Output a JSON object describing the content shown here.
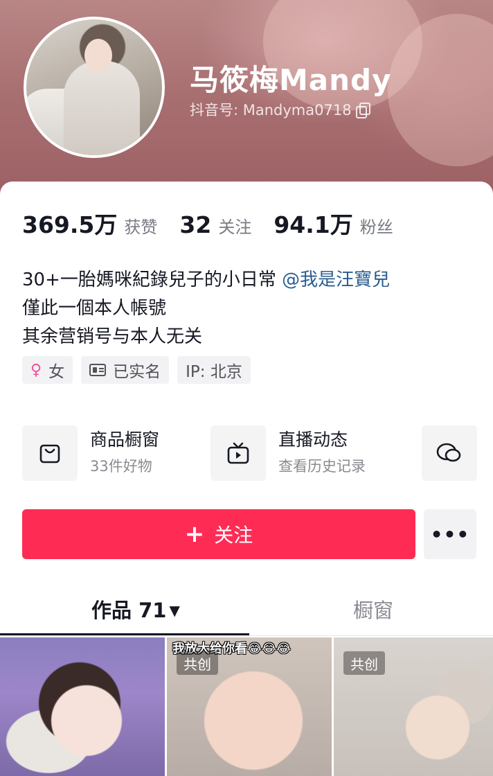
{
  "profile": {
    "name": "马筱梅Mandy",
    "account_id": "抖音号: Mandyma0718"
  },
  "stats": [
    {
      "value": "369.5万",
      "label": "获赞"
    },
    {
      "value": "32",
      "label": "关注"
    },
    {
      "value": "94.1万",
      "label": "粉丝"
    }
  ],
  "bio": {
    "line1": "30+一胎媽咪紀錄兒子的小日常 ",
    "mention": "@我是汪寶兒",
    "line2": "僅此一個本人帳號",
    "line3": "其余营销号与本人无关"
  },
  "tags": {
    "gender": "女",
    "verified": "已实名",
    "ip": "IP: 北京"
  },
  "features": [
    {
      "title": "商品橱窗",
      "subtitle": "33件好物",
      "icon": "shopping-bag-icon"
    },
    {
      "title": "直播动态",
      "subtitle": "查看历史记录",
      "icon": "tv-play-icon"
    },
    {
      "title": "",
      "subtitle": "",
      "icon": "chat-bubble-icon"
    }
  ],
  "actions": {
    "follow_plus": "+",
    "follow_label": "关注",
    "more_label": "•••"
  },
  "tabs": {
    "works_label": "作品 71",
    "works_arrow": "▼",
    "window_label": "橱窗"
  },
  "thumbnails": [
    {
      "overlay": "",
      "badge": ""
    },
    {
      "overlay": "我放大给你看😂😂😂",
      "badge": "共创"
    },
    {
      "overlay": "",
      "badge": "共创"
    }
  ],
  "colors": {
    "accent": "#fe2c55",
    "mention": "#2a5d8f",
    "banner": "#a86f71"
  }
}
